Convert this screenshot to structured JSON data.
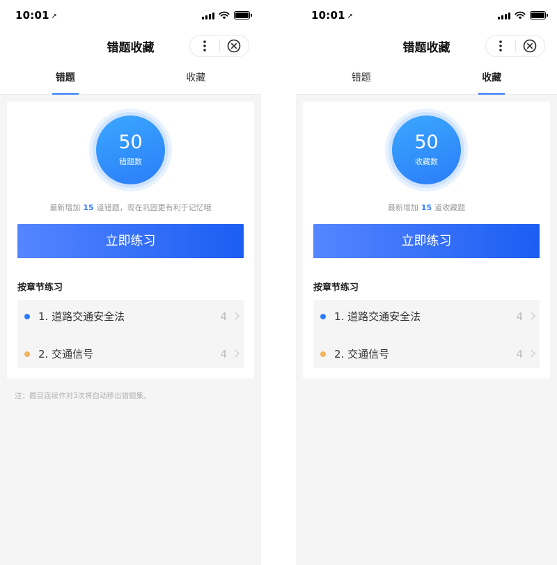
{
  "colors": {
    "accent": "#2f7bff",
    "dot_blue": "#2f7bff",
    "dot_orange": "#f3b35a",
    "button_start": "#5585ff",
    "button_end": "#1b5ef2"
  },
  "screens": [
    {
      "status_time": "10:01",
      "nav_title": "错题收藏",
      "tabs": [
        {
          "label": "错题",
          "active": true
        },
        {
          "label": "收藏",
          "active": false
        }
      ],
      "count": "50",
      "count_label": "错题数",
      "hint": {
        "prefix": "最新增加",
        "number": "15",
        "suffix": "道错题，现在巩固更有利于记忆哦"
      },
      "button_label": "立即练习",
      "section_title": "按章节练习",
      "chapters": [
        {
          "label": "1. 道路交通安全法",
          "count": "4",
          "dot_color": "#2f7bff"
        },
        {
          "label": "2. 交通信号",
          "count": "4",
          "dot_color": "#f3b35a"
        }
      ],
      "note": "注：题目连续作对3次将自动移出错题集。"
    },
    {
      "status_time": "10:01",
      "nav_title": "错题收藏",
      "tabs": [
        {
          "label": "错题",
          "active": false
        },
        {
          "label": "收藏",
          "active": true
        }
      ],
      "count": "50",
      "count_label": "收藏数",
      "hint": {
        "prefix": "最新增加",
        "number": "15",
        "suffix": "道收藏题"
      },
      "button_label": "立即练习",
      "section_title": "按章节练习",
      "chapters": [
        {
          "label": "1. 道路交通安全法",
          "count": "4",
          "dot_color": "#2f7bff"
        },
        {
          "label": "2. 交通信号",
          "count": "4",
          "dot_color": "#f3b35a"
        }
      ],
      "note": ""
    }
  ]
}
